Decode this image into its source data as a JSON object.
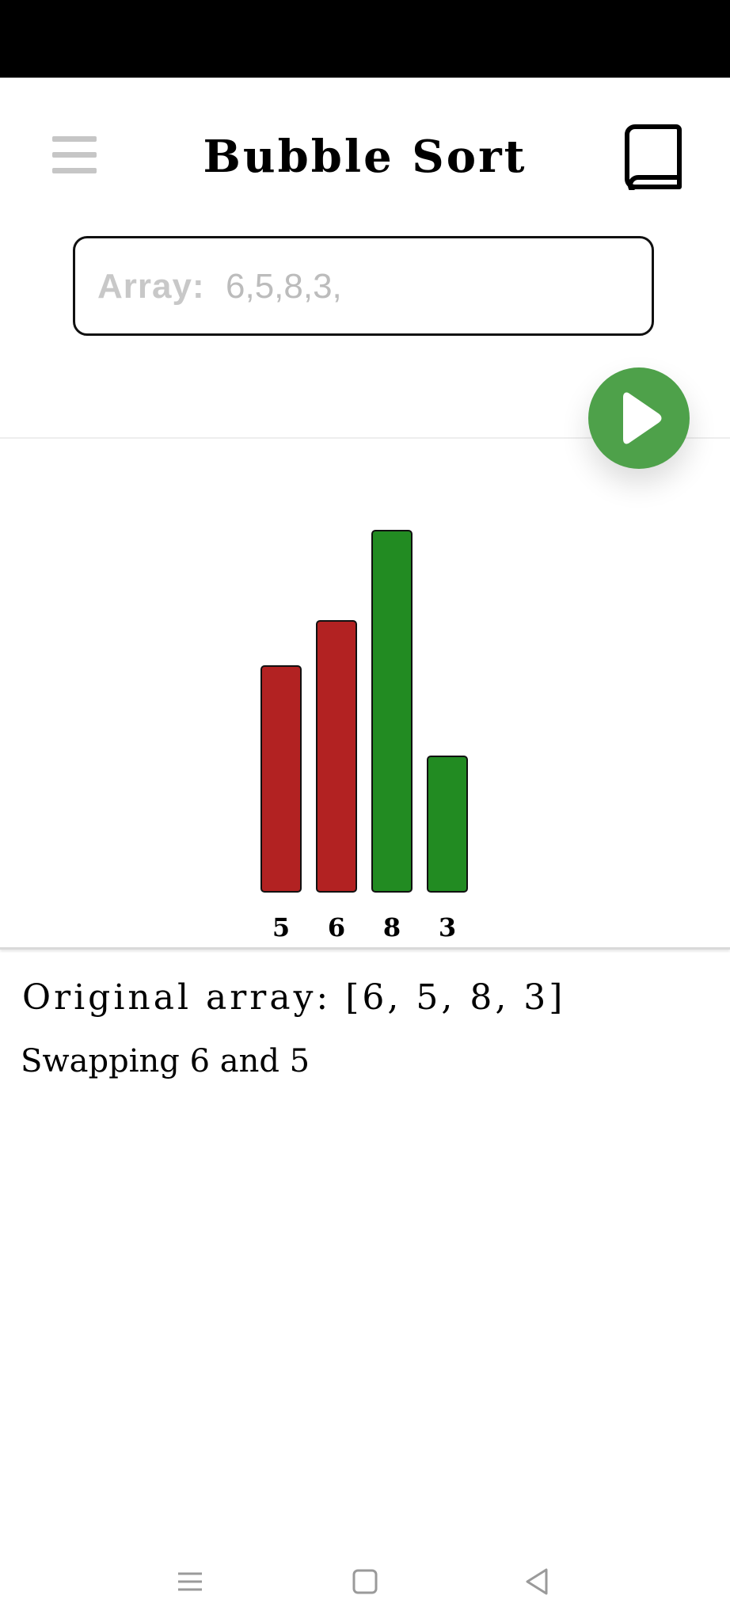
{
  "header": {
    "title": "Bubble Sort",
    "menu_icon": "hamburger-menu-icon",
    "book_icon": "book-icon"
  },
  "array_input": {
    "label": "Array:",
    "value": "6,5,8,3,"
  },
  "play_button": {
    "icon": "play-icon",
    "color": "#4ea14a"
  },
  "chart_data": {
    "type": "bar",
    "categories": [
      "5",
      "6",
      "8",
      "3"
    ],
    "values": [
      5,
      6,
      8,
      3
    ],
    "bar_colors": [
      "#b22222",
      "#b22222",
      "#228b22",
      "#228b22"
    ],
    "ylim": [
      0,
      8
    ],
    "grid": false
  },
  "log": {
    "original_array": "Original array: [6, 5, 8, 3]",
    "step": "Swapping 6 and 5"
  },
  "colors": {
    "compare": "#b22222",
    "neutral": "#228b22"
  },
  "system_nav": {
    "recents_icon": "recents-icon",
    "home_icon": "home-icon",
    "back_icon": "back-icon"
  }
}
